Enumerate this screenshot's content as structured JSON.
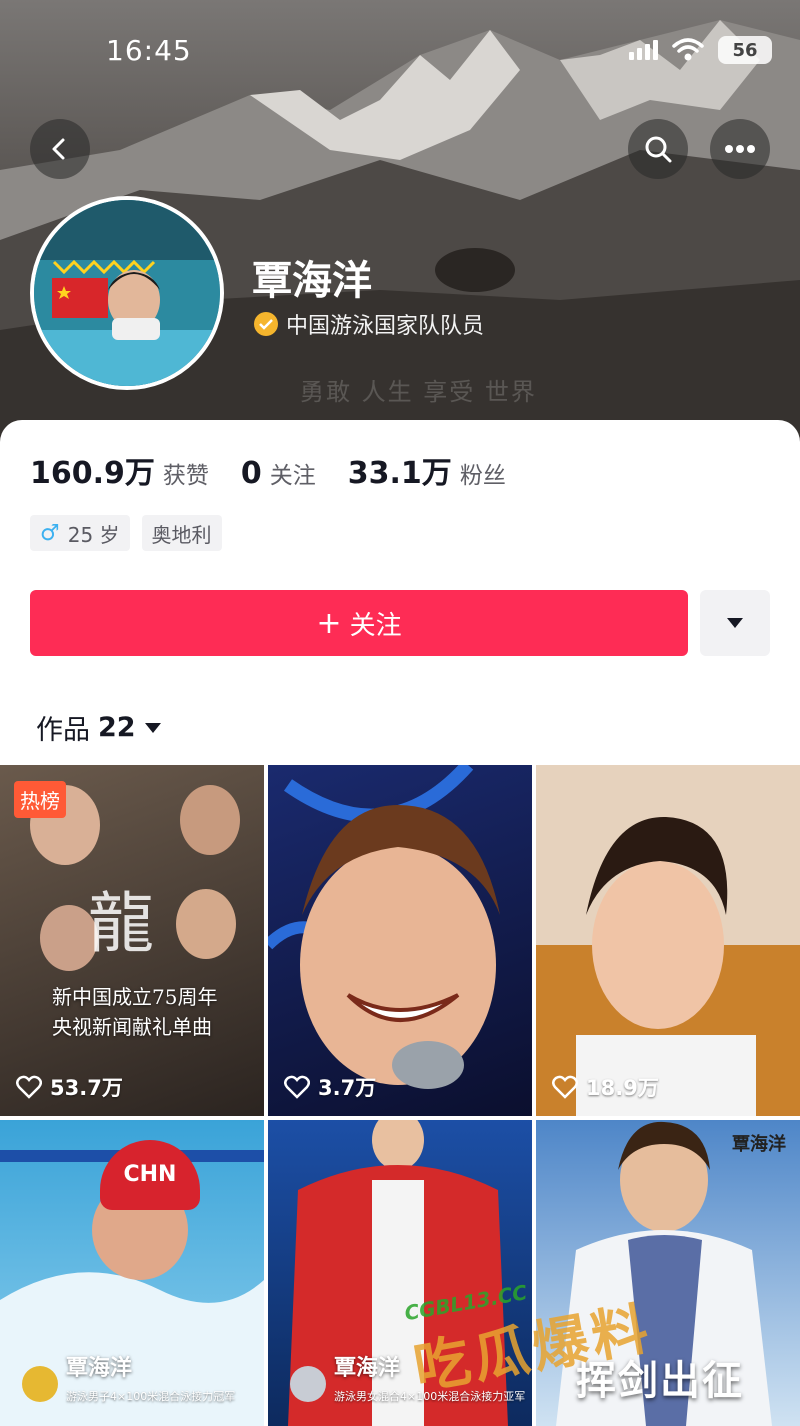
{
  "status_bar": {
    "time": "16:45",
    "battery": "56"
  },
  "profile": {
    "name": "覃海洋",
    "verification": "中国游泳国家队队员",
    "cover_motto": "勇敢 人生 享受 世界",
    "stats": [
      {
        "value": "160.9万",
        "label": "获赞"
      },
      {
        "value": "0",
        "label": "关注"
      },
      {
        "value": "33.1万",
        "label": "粉丝"
      }
    ],
    "tags": [
      {
        "icon": "male-icon",
        "symbol": "♂",
        "text": "25 岁"
      },
      {
        "text": "奥地利"
      }
    ]
  },
  "actions": {
    "follow_label": "关注",
    "follow_prefix": "+"
  },
  "works": {
    "label": "作品",
    "count": "22"
  },
  "grid": [
    {
      "badge": "热榜",
      "calligraphy": "龍",
      "line1": "新中国成立75周年",
      "line2": "央视新闻献礼单曲",
      "likes": "53.7万"
    },
    {
      "likes": "3.7万"
    },
    {
      "likes": "18.9万"
    },
    {
      "cap_text": "CHN",
      "name": "覃海洋",
      "subtitle": "游泳男子4×100米混合泳接力冠军"
    },
    {
      "name": "覃海洋",
      "subtitle": "游泳男女混合4×100米混合泳接力亚军"
    },
    {
      "corner_name": "覃海洋",
      "big_text": "挥剑出征"
    }
  ],
  "watermark": {
    "url": "CGBL13.CC",
    "text": "吃瓜爆料"
  },
  "colors": {
    "follow": "#fe2c55",
    "hot_badge": "#ff5a36",
    "verify": "#f5b52d",
    "male": "#3db1f0"
  }
}
